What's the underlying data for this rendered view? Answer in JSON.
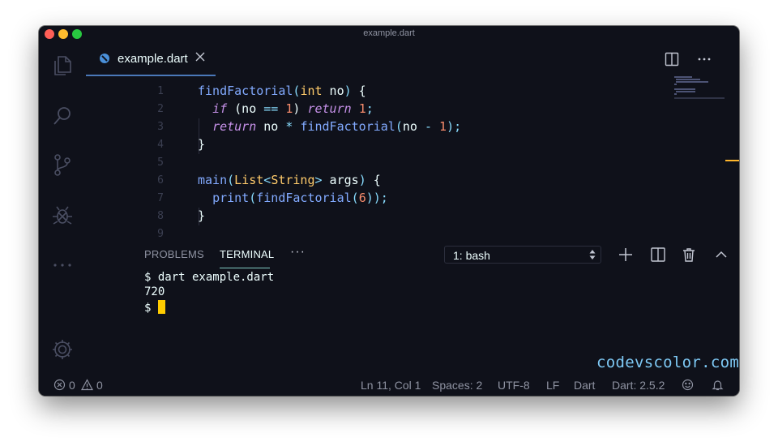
{
  "window": {
    "title": "example.dart"
  },
  "tab": {
    "label": "example.dart"
  },
  "editor": {
    "lines": [
      {
        "n": "1",
        "tokens": [
          [
            "fn",
            "findFactorial"
          ],
          [
            "pun",
            "("
          ],
          [
            "type",
            "int"
          ],
          [
            "var",
            " no"
          ],
          [
            "pun",
            ")"
          ],
          [
            "var",
            " {"
          ]
        ]
      },
      {
        "n": "2",
        "tokens": [
          [
            "var",
            "  "
          ],
          [
            "kw",
            "if"
          ],
          [
            "var",
            " (no "
          ],
          [
            "pun",
            "=="
          ],
          [
            "var",
            " "
          ],
          [
            "num",
            "1"
          ],
          [
            "var",
            ") "
          ],
          [
            "kw",
            "return"
          ],
          [
            "var",
            " "
          ],
          [
            "num",
            "1"
          ],
          [
            "pun",
            ";"
          ]
        ]
      },
      {
        "n": "3",
        "tokens": [
          [
            "var",
            "  "
          ],
          [
            "kw",
            "return"
          ],
          [
            "var",
            " no "
          ],
          [
            "pun",
            "*"
          ],
          [
            "var",
            " "
          ],
          [
            "fn",
            "findFactorial"
          ],
          [
            "pun",
            "("
          ],
          [
            "var",
            "no "
          ],
          [
            "pun",
            "-"
          ],
          [
            "var",
            " "
          ],
          [
            "num",
            "1"
          ],
          [
            "pun",
            ");"
          ]
        ]
      },
      {
        "n": "4",
        "tokens": [
          [
            "var",
            "}"
          ]
        ]
      },
      {
        "n": "5",
        "tokens": []
      },
      {
        "n": "6",
        "tokens": [
          [
            "fn",
            "main"
          ],
          [
            "pun",
            "("
          ],
          [
            "type",
            "List"
          ],
          [
            "pun",
            "<"
          ],
          [
            "type",
            "String"
          ],
          [
            "pun",
            ">"
          ],
          [
            "var",
            " args"
          ],
          [
            "pun",
            ")"
          ],
          [
            "var",
            " {"
          ]
        ]
      },
      {
        "n": "7",
        "tokens": [
          [
            "var",
            "  "
          ],
          [
            "fn",
            "print"
          ],
          [
            "pun",
            "("
          ],
          [
            "fn",
            "findFactorial"
          ],
          [
            "pun",
            "("
          ],
          [
            "num",
            "6"
          ],
          [
            "pun",
            "));"
          ]
        ]
      },
      {
        "n": "8",
        "tokens": [
          [
            "var",
            "}"
          ]
        ]
      },
      {
        "n": "9",
        "tokens": []
      }
    ]
  },
  "panel": {
    "tabs": [
      "PROBLEMS",
      "TERMINAL"
    ],
    "more": "···",
    "terminal_select": "1: bash",
    "terminal_lines": [
      "$ dart example.dart",
      "720",
      "$ "
    ]
  },
  "watermark": "codevscolor.com",
  "status": {
    "errors": "0",
    "warnings": "0",
    "position": "Ln 11, Col 1",
    "spaces": "Spaces: 2",
    "encoding": "UTF-8",
    "eol": "LF",
    "language": "Dart",
    "sdk": "Dart: 2.5.2"
  },
  "colors": {
    "background": "#0f111a",
    "function": "#82aaff",
    "type": "#ffcb6b",
    "keyword": "#c792ea",
    "number": "#f78c6c",
    "punctuation": "#89ddff",
    "cursor": "#ffcc00",
    "accent": "#80cbc4"
  },
  "icons": {
    "activity": [
      "files-icon",
      "search-icon",
      "source-control-icon",
      "debug-icon",
      "more-icon",
      "settings-gear-icon"
    ],
    "panel_actions": [
      "new-terminal-icon",
      "split-terminal-icon",
      "kill-terminal-icon",
      "maximize-panel-icon",
      "close-panel-icon"
    ]
  }
}
